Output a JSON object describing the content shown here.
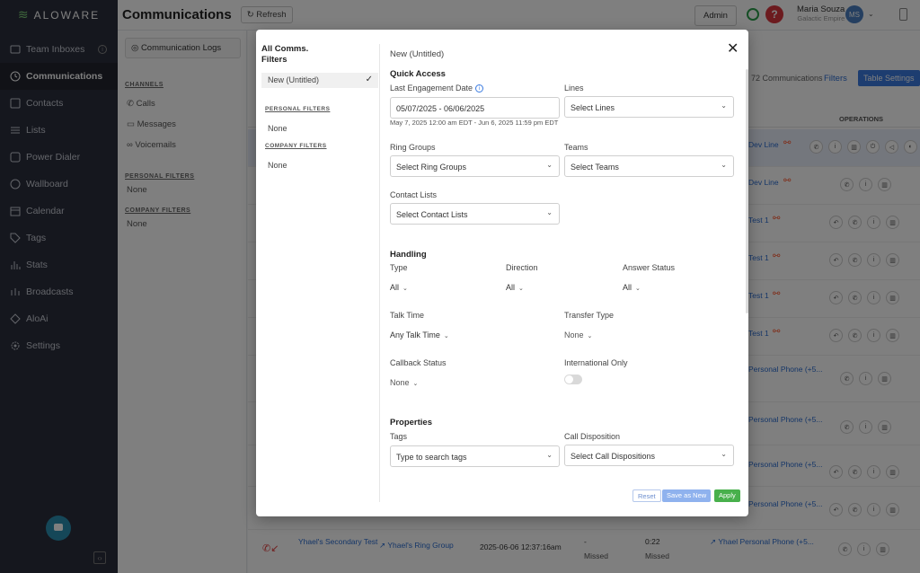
{
  "sidebar": {
    "brand": "ALOWARE",
    "items": [
      {
        "label": "Team Inboxes",
        "icon": "inbox-icon"
      },
      {
        "label": "Communications",
        "icon": "clock-icon"
      },
      {
        "label": "Contacts",
        "icon": "contacts-icon"
      },
      {
        "label": "Lists",
        "icon": "list-icon"
      },
      {
        "label": "Power Dialer",
        "icon": "power-dialer-icon"
      },
      {
        "label": "Wallboard",
        "icon": "wallboard-icon"
      },
      {
        "label": "Calendar",
        "icon": "calendar-icon"
      },
      {
        "label": "Tags",
        "icon": "tag-icon"
      },
      {
        "label": "Stats",
        "icon": "stats-icon"
      },
      {
        "label": "Broadcasts",
        "icon": "broadcast-icon"
      },
      {
        "label": "AloAi",
        "icon": "ai-icon"
      },
      {
        "label": "Settings",
        "icon": "gear-icon"
      }
    ]
  },
  "header": {
    "title": "Communications",
    "refresh_label": "Refresh",
    "admin_label": "Admin",
    "help_label": "?",
    "user_name": "Maria Souza",
    "user_org": "Galactic Empire",
    "user_initials": "MS"
  },
  "subpanel": {
    "comm_logs_label": "Communication Logs",
    "channels_heading": "CHANNELS",
    "channels": [
      "Calls",
      "Messages",
      "Voicemails"
    ],
    "personal_filters_heading": "PERSONAL FILTERS",
    "personal_none": "None",
    "company_filters_heading": "COMPANY FILTERS",
    "company_none": "None"
  },
  "main": {
    "comm_count": "72 Communications",
    "filters_label": "Filters",
    "table_settings_label": "Table Settings",
    "operations_header": "OPERATIONS",
    "row_lines": [
      "Dev Line",
      "Dev Line",
      "Test 1",
      "Test 1",
      "Test 1",
      "Test 1"
    ],
    "side_lines": [
      "Personal Phone (+5...",
      "Personal Phone (+5...",
      "Personal Phone (+5...",
      "Personal Phone (+5..."
    ],
    "last_row": {
      "contact": "Yhael's Secondary Test",
      "ring_group": "Yhael's Ring Group",
      "datetime": "2025-06-06 12:37:16am",
      "dash": "-",
      "status1": "Missed",
      "talk_time": "0:22",
      "status2": "Missed",
      "line": "Yhael Personal Phone (+5..."
    }
  },
  "modal": {
    "left_title": "All Comms. Filters",
    "selected_filter": "New (Untitled)",
    "personal_filters_heading": "PERSONAL FILTERS",
    "personal_none": "None",
    "company_filters_heading": "COMPANY FILTERS",
    "company_none": "None",
    "filter_name": "New (Untitled)",
    "quick_access_heading": "Quick Access",
    "last_engagement_label": "Last Engagement Date",
    "date_range_value": "05/07/2025 - 06/06/2025",
    "date_range_hint": "May 7, 2025 12:00 am EDT - Jun 6, 2025 11:59 pm EDT",
    "lines_label": "Lines",
    "lines_placeholder": "Select Lines",
    "ring_groups_label": "Ring Groups",
    "ring_groups_placeholder": "Select Ring Groups",
    "teams_label": "Teams",
    "teams_placeholder": "Select Teams",
    "contact_lists_label": "Contact Lists",
    "contact_lists_placeholder": "Select Contact Lists",
    "handling_heading": "Handling",
    "type_label": "Type",
    "type_value": "All",
    "direction_label": "Direction",
    "direction_value": "All",
    "answer_status_label": "Answer Status",
    "answer_status_value": "All",
    "talk_time_label": "Talk Time",
    "talk_time_value": "Any Talk Time",
    "transfer_type_label": "Transfer Type",
    "transfer_type_value": "None",
    "callback_status_label": "Callback Status",
    "callback_status_value": "None",
    "international_only_label": "International Only",
    "international_only_on": false,
    "properties_heading": "Properties",
    "tags_label": "Tags",
    "tags_placeholder": "Type to search tags",
    "call_disposition_label": "Call Disposition",
    "call_disposition_placeholder": "Select Call Dispositions",
    "reset_label": "Reset",
    "save_as_new_label": "Save as New",
    "apply_label": "Apply"
  },
  "colors": {
    "sidebar_bg": "#2b2f3d",
    "accent_blue": "#3b7be0",
    "apply_green": "#48b04c",
    "help_red": "#d9363e"
  }
}
